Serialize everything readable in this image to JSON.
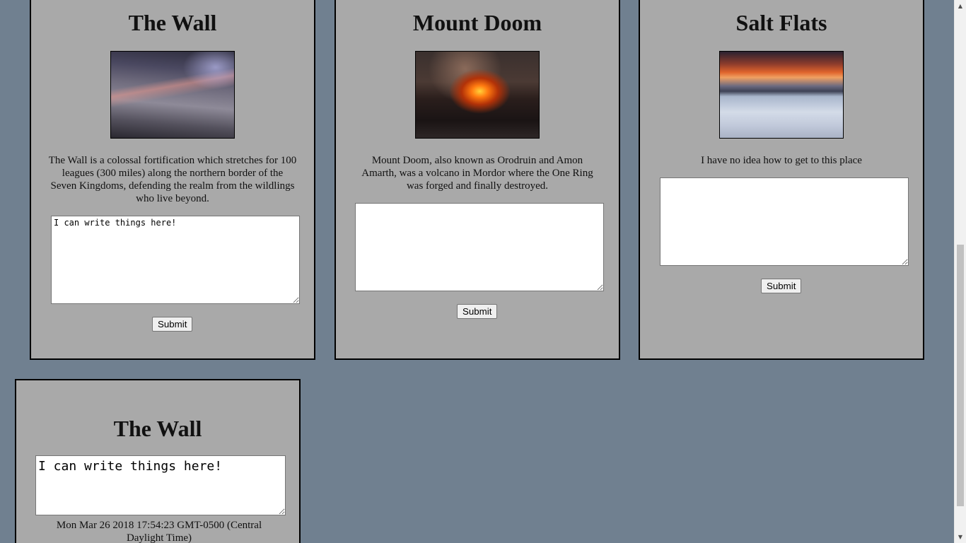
{
  "cards": [
    {
      "title": "The Wall",
      "image_alt": "The Wall",
      "description": "The Wall is a colossal fortification which stretches for 100 leagues (300 miles) along the northern border of the Seven Kingdoms, defending the realm from the wildlings who live beyond.",
      "textarea_value": "I can write things here!",
      "button_label": "Submit"
    },
    {
      "title": "Mount Doom",
      "image_alt": "Mount Doom",
      "description": "Mount Doom, also known as Orodruin and Amon Amarth, was a volcano in Mordor where the One Ring was forged and finally destroyed.",
      "textarea_value": "",
      "button_label": "Submit"
    },
    {
      "title": "Salt Flats",
      "image_alt": "Salt Flats",
      "description": "I have no idea how to get to this place",
      "textarea_value": "",
      "button_label": "Submit"
    }
  ],
  "result_card": {
    "title": "The Wall",
    "textarea_value": "I can write things here!",
    "timestamp": "Mon Mar 26 2018 17:54:23 GMT-0500 (Central Daylight Time)"
  },
  "scrollbar": {
    "up_icon": "arrow-up-icon",
    "down_icon": "arrow-down-icon"
  }
}
